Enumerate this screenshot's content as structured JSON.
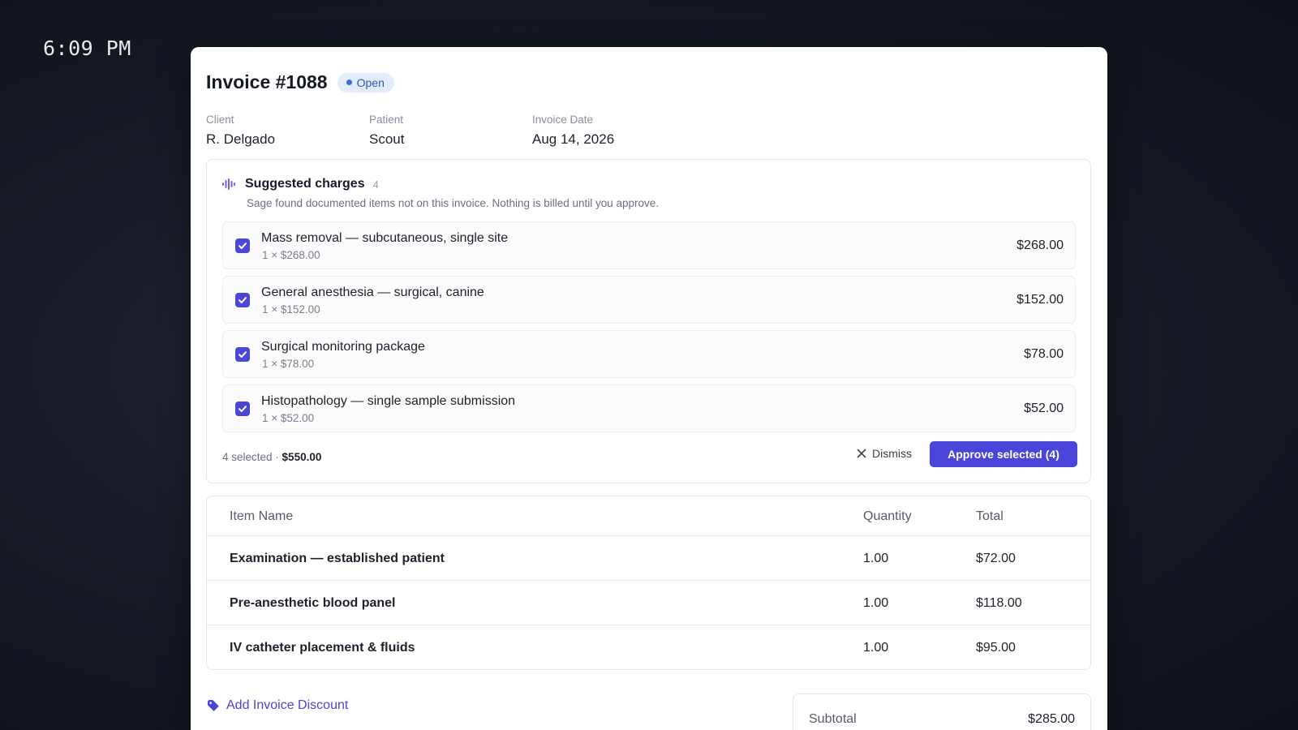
{
  "clock": "6:09 PM",
  "invoice": {
    "title": "Invoice #1088",
    "status": "Open",
    "status_color": "#3b6fd6",
    "meta": [
      {
        "label": "Client",
        "value": "R. Delgado"
      },
      {
        "label": "Patient",
        "value": "Scout"
      },
      {
        "label": "Invoice Date",
        "value": "Aug 14, 2026"
      }
    ]
  },
  "suggested": {
    "title": "Suggested charges",
    "count": "4",
    "icon": "waveform-icon",
    "description": "Sage found documented items not on this invoice. Nothing is billed until you approve.",
    "charges": [
      {
        "name": "Mass removal — subcutaneous, single site",
        "qty": "1 × $268.00",
        "amount": "$268.00",
        "checked": true
      },
      {
        "name": "General anesthesia — surgical, canine",
        "qty": "1 × $152.00",
        "amount": "$152.00",
        "checked": true
      },
      {
        "name": "Surgical monitoring package",
        "qty": "1 × $78.00",
        "amount": "$78.00",
        "checked": true
      },
      {
        "name": "Histopathology — single sample submission",
        "qty": "1 × $52.00",
        "amount": "$52.00",
        "checked": true
      }
    ],
    "selected_text": "4 selected · ",
    "selected_total": "$550.00",
    "dismiss_label": "Dismiss",
    "approve_label": "Approve selected (4)",
    "accent_color": "#4a44d8"
  },
  "items_table": {
    "headers": [
      "Item Name",
      "Quantity",
      "Total"
    ],
    "rows": [
      [
        "Examination — established patient",
        "1.00",
        "$72.00"
      ],
      [
        "Pre-anesthetic blood panel",
        "1.00",
        "$118.00"
      ],
      [
        "IV catheter placement & fluids",
        "1.00",
        "$95.00"
      ]
    ]
  },
  "discount_label": "Add Invoice Discount",
  "totals": {
    "subtotal_label": "Subtotal",
    "subtotal_value": "$285.00"
  }
}
